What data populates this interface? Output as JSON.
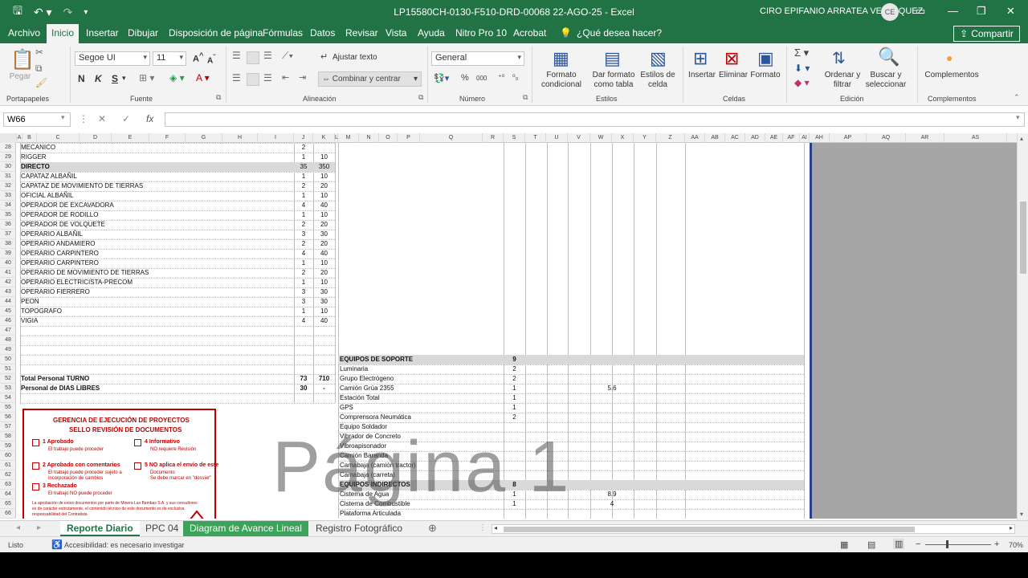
{
  "titlebar": {
    "doc_title": "LP15580CH-0130-F510-DRD-00068 22-AGO-25  -  Excel",
    "user_name": "CIRO EPIFANIO ARRATEA VELASQUEZ",
    "user_initials": "CE"
  },
  "ribbon_tabs": [
    "Archivo",
    "Inicio",
    "Insertar",
    "Dibujar",
    "Disposición de página",
    "Fórmulas",
    "Datos",
    "Revisar",
    "Vista",
    "Ayuda",
    "Nitro Pro 10",
    "Acrobat",
    "¿Qué desea hacer?"
  ],
  "share_label": "Compartir",
  "ribbon": {
    "paste_label": "Pegar",
    "font_name": "Segoe UI",
    "font_size": "11",
    "bold": "N",
    "italic": "K",
    "underline": "S",
    "wrap_text": "Ajustar texto",
    "merge_center": "Combinar y centrar",
    "number_format": "General",
    "cond_format": "Formato condicional",
    "table_format": "Dar formato como tabla",
    "cell_styles": "Estilos de celda",
    "insert": "Insertar",
    "delete": "Eliminar",
    "format": "Formato",
    "sort_filter": "Ordenar y filtrar",
    "find_select": "Buscar y seleccionar",
    "addins": "Complementos",
    "groups": {
      "clipboard": "Portapapeles",
      "font": "Fuente",
      "alignment": "Alineación",
      "number": "Número",
      "styles": "Estilos",
      "cells": "Celdas",
      "editing": "Edición",
      "addins": "Complementos"
    }
  },
  "formula_bar": {
    "name_box": "W66",
    "fx": "fx",
    "content": ""
  },
  "columns": [
    {
      "label": "A"
    },
    {
      "label": "B"
    },
    {
      "label": "C"
    },
    {
      "label": "D"
    },
    {
      "label": "E"
    },
    {
      "label": "F"
    },
    {
      "label": "G"
    },
    {
      "label": "H"
    },
    {
      "label": "I"
    },
    {
      "label": "J"
    },
    {
      "label": "K"
    },
    {
      "label": "L"
    },
    {
      "label": "M"
    },
    {
      "label": "N"
    },
    {
      "label": "O"
    },
    {
      "label": "P"
    },
    {
      "label": "Q"
    },
    {
      "label": "R"
    },
    {
      "label": "S"
    },
    {
      "label": "T"
    },
    {
      "label": "U"
    },
    {
      "label": "V"
    },
    {
      "label": "W"
    },
    {
      "label": "X"
    },
    {
      "label": "Y"
    },
    {
      "label": "Z"
    },
    {
      "label": "AA"
    },
    {
      "label": "AB"
    },
    {
      "label": "AC"
    },
    {
      "label": "AD"
    },
    {
      "label": "AE"
    },
    {
      "label": "AF"
    },
    {
      "label": "AI"
    },
    {
      "label": "AH"
    },
    {
      "label": "AP"
    },
    {
      "label": "AQ"
    },
    {
      "label": "AR"
    },
    {
      "label": "AS"
    }
  ],
  "rows": [
    "28",
    "29",
    "30",
    "31",
    "32",
    "33",
    "34",
    "35",
    "36",
    "37",
    "38",
    "39",
    "40",
    "41",
    "42",
    "43",
    "44",
    "45",
    "46",
    "47",
    "48",
    "49",
    "50",
    "51",
    "52",
    "53",
    "54",
    "55",
    "56",
    "57",
    "58",
    "59",
    "60",
    "61",
    "62",
    "63",
    "64",
    "65",
    "66"
  ],
  "personnel": [
    {
      "name": "MECANICO",
      "j": "2",
      "k": ""
    },
    {
      "name": "RIGGER",
      "j": "1",
      "k": "10"
    },
    {
      "name": "DIRECTO",
      "j": "35",
      "k": "350"
    },
    {
      "name": "CAPATAZ ALBAÑIL",
      "j": "1",
      "k": "10"
    },
    {
      "name": "CAPATAZ DE MOVIMIENTO DE TIERRAS",
      "j": "2",
      "k": "20"
    },
    {
      "name": "OFICIAL ALBAÑIL",
      "j": "1",
      "k": "10"
    },
    {
      "name": "OPERADOR DE EXCAVADORA",
      "j": "4",
      "k": "40"
    },
    {
      "name": "OPERADOR DE RODILLO",
      "j": "1",
      "k": "10"
    },
    {
      "name": "OPERADOR DE VOLQUETE",
      "j": "2",
      "k": "20"
    },
    {
      "name": "OPERARIO ALBAÑIL",
      "j": "3",
      "k": "30"
    },
    {
      "name": "OPERARIO ANDAMIERO",
      "j": "2",
      "k": "20"
    },
    {
      "name": "OPERARIO CARPINTERO",
      "j": "4",
      "k": "40"
    },
    {
      "name": "OPERARIO CARPINTERO",
      "j": "1",
      "k": "10"
    },
    {
      "name": "OPERARIO DE MOVIMIENTO DE TIERRAS",
      "j": "2",
      "k": "20"
    },
    {
      "name": "OPERARIO ELECTRICISTA-PRECOM",
      "j": "1",
      "k": "10"
    },
    {
      "name": "OPERARIO FIERRERO",
      "j": "3",
      "k": "30"
    },
    {
      "name": "PEON",
      "j": "3",
      "k": "30"
    },
    {
      "name": "TOPOGRAFO",
      "j": "1",
      "k": "10"
    },
    {
      "name": "VIGIA",
      "j": "4",
      "k": "40"
    }
  ],
  "totals": [
    {
      "name": "Total Personal TURNO",
      "j": "73",
      "k": "710"
    },
    {
      "name": "Personal de DIAS LIBRES",
      "j": "30",
      "k": "-"
    }
  ],
  "support_equipment": {
    "header": "EQUIPOS DE SOPORTE",
    "count": "9",
    "items": [
      {
        "name": "Luminaria",
        "qty": "2",
        "w": ""
      },
      {
        "name": "Grupo Electrógeno",
        "qty": "2",
        "w": ""
      },
      {
        "name": "Camión Grúa 2355",
        "qty": "1",
        "w": "5.6"
      },
      {
        "name": "Estación Total",
        "qty": "1",
        "w": ""
      },
      {
        "name": "GPS",
        "qty": "1",
        "w": ""
      },
      {
        "name": "Comprensora Neumática",
        "qty": "2",
        "w": ""
      },
      {
        "name": "Equipo Soldador",
        "qty": "",
        "w": ""
      },
      {
        "name": "Vibrador de Concreto",
        "qty": "",
        "w": ""
      },
      {
        "name": "Vibroapisonador",
        "qty": "",
        "w": ""
      },
      {
        "name": "Camión Baranda",
        "qty": "",
        "w": ""
      },
      {
        "name": "Camabaja (camión tractor)",
        "qty": "",
        "w": ""
      },
      {
        "name": "Camabaja (carreta)",
        "qty": "",
        "w": ""
      }
    ]
  },
  "indirect_equipment": {
    "header": "EQUIPOS INDIRECTOS",
    "count": "8",
    "items": [
      {
        "name": "Cisterna de Agua",
        "qty": "1",
        "w": "8.9"
      },
      {
        "name": "Cisterna de Combustible",
        "qty": "1",
        "w": "4"
      },
      {
        "name": "Plataforma Articulada",
        "qty": "",
        "w": ""
      }
    ]
  },
  "stamp": {
    "title1": "GERENCIA DE EJECUCIÓN DE PROYECTOS",
    "title2": "SELLO REVISIÓN DE DOCUMENTOS",
    "opt1": "1 Aprobado",
    "opt1_sub": "El trabajo puede proceder",
    "opt2": "2 Aprobado con comentarios",
    "opt2_sub1": "El trabajo puede proceder sujeto a",
    "opt2_sub2": "incorporación de cambios",
    "opt3": "3 Rechazado",
    "opt3_sub": "El trabajo NO puede proceder",
    "opt4": "4 Informativo",
    "opt4_sub": "NO requiere Revisión",
    "opt5": "5 NO aplica el envío de este",
    "opt5_sub1": "Documento",
    "opt5_sub2": "Se debe marcar en \"dossier\"",
    "footer1": "La aprobación de estos documentos por parte de Minera Las Bambas S.A. y sus consultores",
    "footer2": "es de carácter estrictamente, el contenido técnico de este documento es de exclusiva",
    "footer3": "responsabilidad del Contratista"
  },
  "watermark": "Página 1",
  "sheet_tabs": [
    "Reporte Diario",
    "PPC 04",
    "Diagram de Avance Lineal",
    "Registro Fotográfico"
  ],
  "status": {
    "ready": "Listo",
    "accessibility": "Accesibilidad: es necesario investigar",
    "zoom": "70%"
  },
  "colors": {
    "excel_green": "#217346",
    "stamp_red": "#c00000",
    "page_break": "#2b3f8f"
  }
}
